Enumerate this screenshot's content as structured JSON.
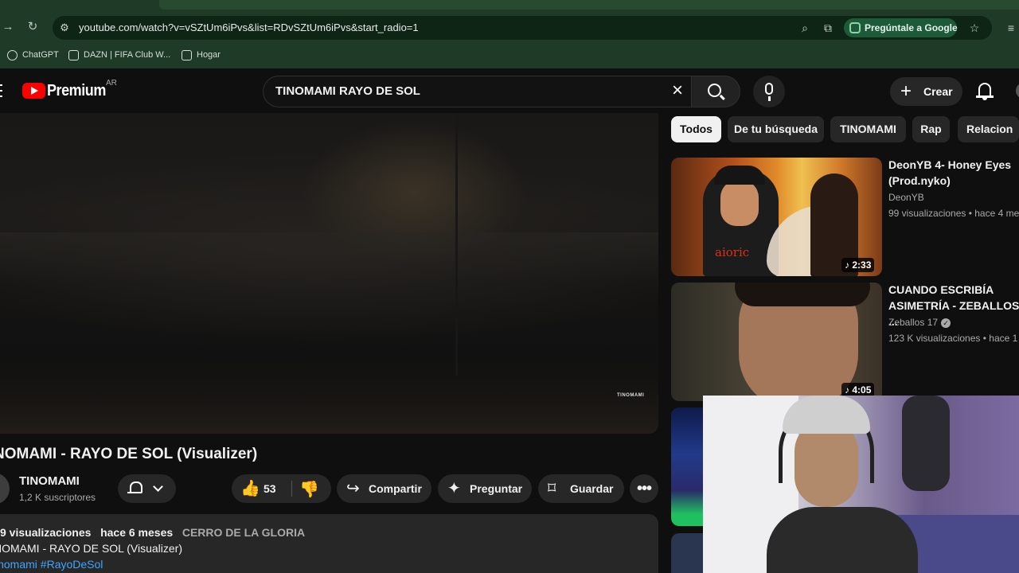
{
  "browser": {
    "url": "youtube.com/watch?v=vSZtUm6iPvs&list=RDvSZtUm6iPvs&start_radio=1",
    "ask_google_label": "Pregúntale a Google",
    "bookmarks": [
      {
        "label": "ChatGPT"
      },
      {
        "label": "DAZN | FIFA Club W..."
      },
      {
        "label": "Hogar"
      }
    ]
  },
  "header": {
    "brand": "Premium",
    "region": "AR",
    "search_value": "TINOMAMI RAYO DE SOL",
    "create_label": "Crear"
  },
  "player": {
    "watermark": "TINOMAMI"
  },
  "video": {
    "title": "NOMAMI - RAYO DE SOL (Visualizer)",
    "channel": "TINOMAMI",
    "subscribers": "1,2 K suscriptores",
    "likes": "53",
    "share_label": "Compartir",
    "ask_label": "Preguntar",
    "save_label": "Guardar",
    "views": "9 visualizaciones",
    "age": "hace 6 meses",
    "location": "CERRO DE LA GLORIA",
    "desc_line": "NOMAMI - RAYO DE SOL (Visualizer)",
    "hashtags": "inomami #RayoDeSol"
  },
  "chips": [
    {
      "label": "Todos",
      "active": true
    },
    {
      "label": "De tu búsqueda"
    },
    {
      "label": "TINOMAMI"
    },
    {
      "label": "Rap"
    },
    {
      "label": "Relacion"
    }
  ],
  "related": [
    {
      "title": "DeonYB 4- Honey Eyes (Prod.nyko)",
      "channel": "DeonYB",
      "meta": "99 visualizaciones • hace 4 me",
      "duration": "2:33",
      "thumb_text": "aioric"
    },
    {
      "title": "CUANDO ESCRIBÍA ASIMETRÍA - ZEBALLOS ...",
      "channel": "Zeballos 17",
      "meta": "123 K visualizaciones • hace 1",
      "duration": "4:05"
    }
  ]
}
